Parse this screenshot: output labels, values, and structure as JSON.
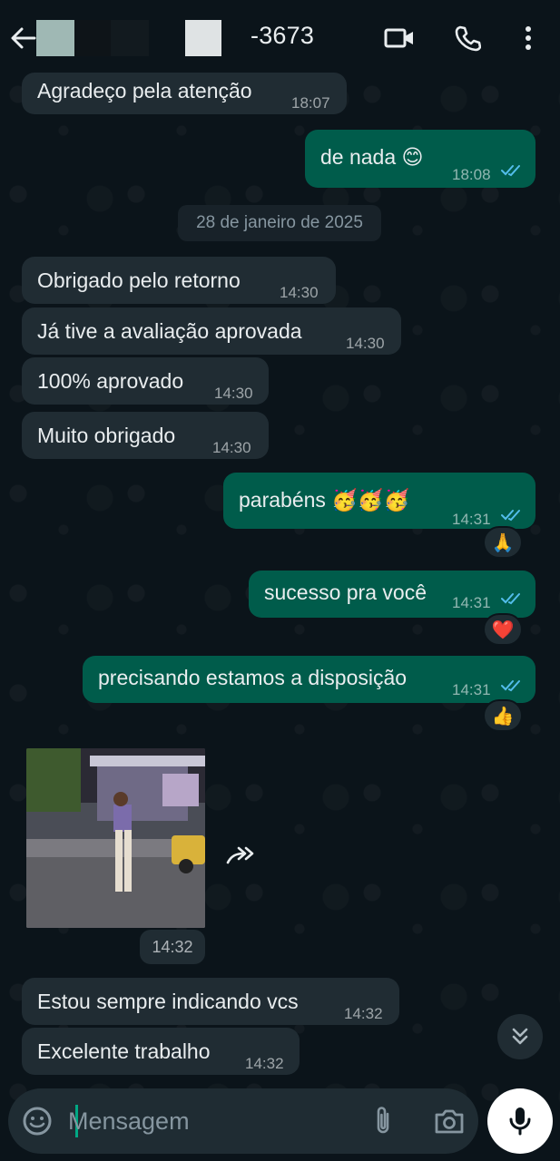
{
  "header": {
    "contact_name": "-3673",
    "icons": [
      "back-arrow-icon",
      "video-call-icon",
      "voice-call-icon",
      "more-vert-icon"
    ]
  },
  "date_divider": "28 de janeiro de 2025",
  "messages": [
    {
      "dir": "in",
      "text": "Agradeço pela atenção",
      "time": "18:07"
    },
    {
      "dir": "out",
      "text": "de nada 😊",
      "time": "18:08",
      "status": "read"
    },
    {
      "dir": "in",
      "text": "Obrigado pelo retorno",
      "time": "14:30"
    },
    {
      "dir": "in",
      "text": "Já tive a avaliação aprovada",
      "time": "14:30"
    },
    {
      "dir": "in",
      "text": "100% aprovado",
      "time": "14:30"
    },
    {
      "dir": "in",
      "text": "Muito obrigado",
      "time": "14:30"
    },
    {
      "dir": "out",
      "text": "parabéns 🥳🥳🥳",
      "time": "14:31",
      "status": "read",
      "reaction": "🙏"
    },
    {
      "dir": "out",
      "text": "sucesso pra você",
      "time": "14:31",
      "status": "read",
      "reaction": "❤️"
    },
    {
      "dir": "out",
      "text": "precisando estamos a disposição",
      "time": "14:31",
      "status": "read",
      "reaction": "👍"
    },
    {
      "dir": "in",
      "type": "video",
      "time": "14:32"
    },
    {
      "dir": "in",
      "text": "Estou sempre indicando vcs",
      "time": "14:32"
    },
    {
      "dir": "in",
      "text": "Excelente trabalho",
      "time": "14:32"
    }
  ],
  "composer": {
    "placeholder": "Mensagem",
    "icons": [
      "emoji-icon",
      "attach-icon",
      "camera-icon",
      "mic-icon"
    ]
  },
  "colors": {
    "background": "#0b141a",
    "incoming_bubble": "#202c33",
    "outgoing_bubble": "#005c4b",
    "read_ticks": "#53bdeb"
  }
}
